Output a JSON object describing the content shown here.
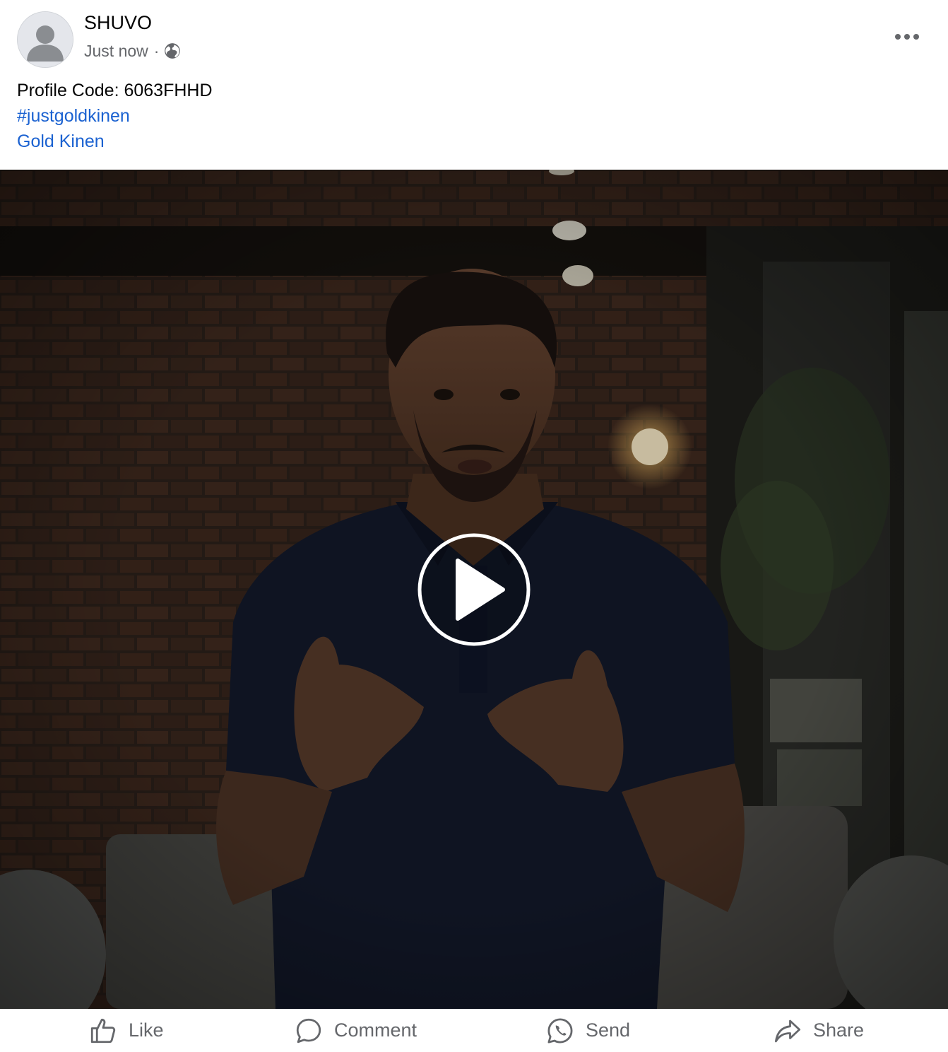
{
  "post": {
    "author": "SHUVO",
    "timestamp": "Just now",
    "separator": "·",
    "privacy_icon": "globe-icon",
    "menu_icon": "more-horizontal-icon",
    "caption": {
      "profile_code": "Profile Code: 6063FHHD",
      "hashtag": "#justgoldkinen",
      "link_text": "Gold Kinen"
    }
  },
  "video": {
    "play_icon": "play-circle-icon"
  },
  "actions": {
    "like": {
      "label": "Like",
      "icon": "thumbs-up-icon"
    },
    "comment": {
      "label": "Comment",
      "icon": "comment-bubble-icon"
    },
    "send": {
      "label": "Send",
      "icon": "whatsapp-icon"
    },
    "share": {
      "label": "Share",
      "icon": "share-arrow-icon"
    }
  },
  "colors": {
    "link": "#1b62d1",
    "secondary_text": "#65676b",
    "primary_text": "#050505"
  }
}
